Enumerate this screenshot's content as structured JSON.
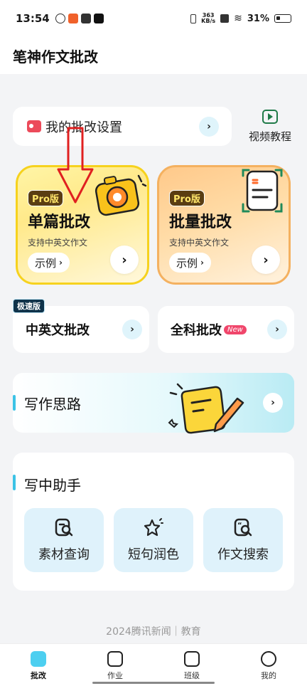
{
  "status_bar": {
    "time": "13:54",
    "net_speed_value": "363",
    "net_speed_unit": "KB/s",
    "battery": "31%"
  },
  "header": {
    "title": "笔神作文批改"
  },
  "settings": {
    "label": "我的批改设置",
    "arrow": "›"
  },
  "video": {
    "label": "视频教程",
    "icon": "play-video-icon"
  },
  "cards": {
    "single": {
      "badge": "Pro版",
      "title": "单篇批改",
      "subtitle": "支持中英文作文",
      "example": "示例",
      "chevron": "›",
      "arrow": "›"
    },
    "batch": {
      "badge": "Pro版",
      "title": "批量批改",
      "subtitle": "支持中英文作文",
      "example": "示例",
      "chevron": "›",
      "arrow": "›"
    }
  },
  "mid": {
    "left": {
      "badge": "极速版",
      "title": "中英文批改",
      "arrow": "›"
    },
    "right": {
      "title": "全科批改",
      "new_badge": "New",
      "arrow": "›"
    }
  },
  "thought": {
    "title": "写作思路",
    "arrow": "›"
  },
  "assistant": {
    "title": "写中助手",
    "tools": [
      {
        "label": "素材查询",
        "icon": "material-search-icon"
      },
      {
        "label": "短句润色",
        "icon": "sparkle-polish-icon"
      },
      {
        "label": "作文搜索",
        "icon": "essay-search-icon"
      }
    ]
  },
  "footer": {
    "text": "2024腾讯新闻｜教育"
  },
  "nav": {
    "items": [
      {
        "label": "批改",
        "active": true
      },
      {
        "label": "作业",
        "active": false
      },
      {
        "label": "班级",
        "active": false
      },
      {
        "label": "我的",
        "active": false
      }
    ]
  },
  "colors": {
    "accent": "#4dcff0",
    "single_border": "#f6d21e",
    "batch_border": "#f4b160",
    "red_arrow": "#e02020"
  }
}
